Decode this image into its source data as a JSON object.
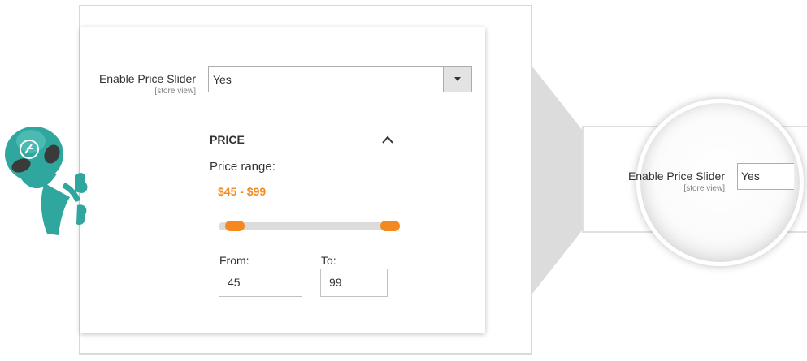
{
  "setting": {
    "label": "Enable Price Slider",
    "scope": "[store view]",
    "selected": "Yes"
  },
  "filter": {
    "title": "PRICE",
    "range_label": "Price range:",
    "range_value": "$45 - $99",
    "slider": {
      "min_value": 45,
      "max_value": 99
    },
    "from_label": "From:",
    "from_value": "45",
    "to_label": "To:",
    "to_value": "99"
  },
  "zoom": {
    "label": "Enable Price Slider",
    "scope": "[store view]",
    "selected": "Yes"
  },
  "colors": {
    "accent": "#f4891f",
    "alien": "#2fa79e"
  },
  "icons": {
    "collapse": "chevron-up-icon",
    "dropdown": "caret-down-icon",
    "mascot": "alien-mascot-icon"
  }
}
